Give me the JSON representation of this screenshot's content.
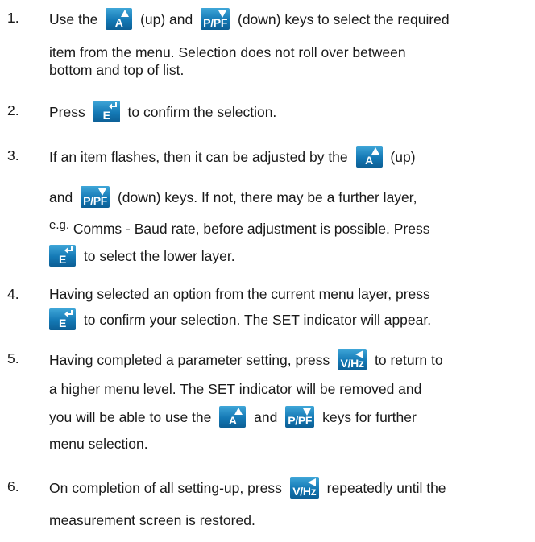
{
  "keys": {
    "up": "A",
    "down": "P/PF",
    "enter": "E",
    "back": "V/Hz"
  },
  "steps": [
    {
      "number": "1.",
      "l1a": "Use the",
      "l1b": "(up) and",
      "l1c": "(down) keys to select the required",
      "l2": "item from the menu.  Selection does not roll over between",
      "l3": "bottom and top of list."
    },
    {
      "number": "2.",
      "l1a": "Press",
      "l1b": "to confirm the selection."
    },
    {
      "number": "3.",
      "l1a": "If an item flashes, then it can be adjusted by the",
      "l1b": "(up)",
      "l2a": "and",
      "l2b": "(down) keys.  If not, there may be a further layer,",
      "l3a": "e.g.",
      "l3b": "Comms - Baud rate, before adjustment is possible.  Press",
      "l4": "to select the lower layer."
    },
    {
      "number": "4.",
      "l1": "Having selected an option from the current menu layer, press",
      "l2": "to confirm your selection.  The SET indicator will appear."
    },
    {
      "number": "5.",
      "l1a": "Having completed a parameter setting, press",
      "l1b": "to return to",
      "l2": "a higher menu level.  The SET indicator will be removed and",
      "l3a": "you will be able to use the",
      "l3b": "and",
      "l3c": "keys for further",
      "l4": "menu selection."
    },
    {
      "number": "6.",
      "l1a": "On completion of all setting-up, press",
      "l1b": "repeatedly until the",
      "l2": "measurement screen is restored."
    }
  ]
}
